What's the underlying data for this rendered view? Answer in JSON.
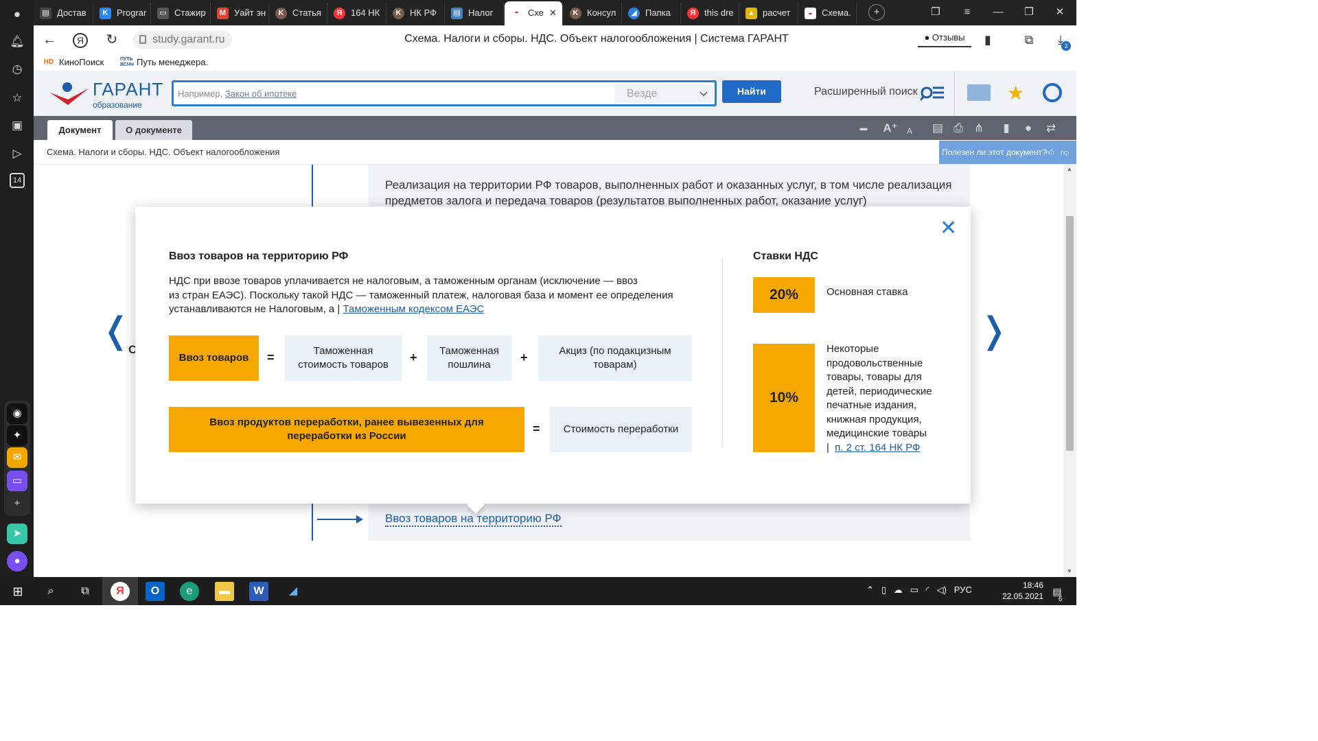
{
  "browser": {
    "tabs": [
      {
        "label": "Достав",
        "icon": "delivery-icon",
        "color": "#444"
      },
      {
        "label": "Prograr",
        "icon": "vk-icon",
        "color": "#2787f5"
      },
      {
        "label": "Стажир",
        "icon": "monitor-icon",
        "color": "#555"
      },
      {
        "label": "Уайт эн",
        "icon": "gmail-icon",
        "color": "#e44134"
      },
      {
        "label": "Статья",
        "icon": "consultant-icon",
        "color": "#7a5a4a"
      },
      {
        "label": "164 НК",
        "icon": "yandex-icon",
        "color": "#f33"
      },
      {
        "label": "НК РФ",
        "icon": "consultant-icon",
        "color": "#7a5a4a"
      },
      {
        "label": "Налог",
        "icon": "doc-icon",
        "color": "#4a7fc0"
      },
      {
        "label": "Схе",
        "icon": "garant-icon",
        "color": "#c22",
        "active": true
      },
      {
        "label": "Консул",
        "icon": "consultant-icon",
        "color": "#7a5a4a"
      },
      {
        "label": "Папка",
        "icon": "folder-icon",
        "color": "#2a80e0"
      },
      {
        "label": "this dre",
        "icon": "yandex-icon",
        "color": "#f33"
      },
      {
        "label": "расчет",
        "icon": "image-icon",
        "color": "#e8b400"
      },
      {
        "label": "Схема.",
        "icon": "garant-icon",
        "color": "#c22"
      }
    ],
    "url": "study.garant.ru",
    "page_title": "Схема. Налоги и сборы. НДС. Объект налогообложения | Система ГАРАНТ",
    "reviews_label": "Отзывы",
    "downloads_badge": "3",
    "bookmarks": [
      {
        "label": "КиноПоиск",
        "icon": "kinopoisk-icon"
      },
      {
        "label": "Путь менеджера.",
        "icon": "put-vsnn-icon"
      }
    ],
    "sidebar_badge": "14"
  },
  "garant": {
    "logo_word": "ГАРАНТ",
    "logo_sub": "образование",
    "search_placeholder_prefix": "Например,",
    "search_placeholder_link": "Закон об ипотеке",
    "search_scope": "Везде",
    "find_button": "Найти",
    "advanced_search": "Расширенный поиск",
    "doc_tabs": [
      "Документ",
      "О документе"
    ],
    "breadcrumb": "Схема. Налоги и сборы. НДС. Объект налогообложения",
    "helpful_prompt": "Полезен ли этот документ?"
  },
  "content": {
    "background_text": "Реализация на территории РФ товаров, выполненных работ и оказанных услуг, в том числе реализация предметов залога и передача товаров (результатов выполненных работ, оказание услуг)",
    "background_link": "Ввоз товаров на территорию РФ",
    "peek_char": "С"
  },
  "modal": {
    "title": "Ввоз товаров на территорию РФ",
    "text_lines": [
      "НДС при ввозе товаров уплачивается не налоговым, а таможенным органам (исключение — ввоз",
      "из  стран ЕАЭС). Поскольку такой НДС — таможенный платеж, налоговая база и момент ее определения",
      "устанавливаются не Налоговым, а  |  "
    ],
    "text_link": "Таможенным кодексом ЕАЭС",
    "formula1": {
      "result": "Ввоз товаров",
      "eq": "=",
      "terms": [
        "Таможенная стоимость товаров",
        "Таможенная пошлина",
        "Акциз (по подакцизным товарам)"
      ],
      "plus": "+"
    },
    "formula2": {
      "result": "Ввоз продуктов переработки, ранее вывезенных для переработки из России",
      "eq": "=",
      "term": "Стоимость переработки"
    },
    "rates_title": "Ставки НДС",
    "rates": [
      {
        "value": "20%",
        "desc": "Основная ставка"
      },
      {
        "value": "10%",
        "desc": "Некоторые продовольственные товары, товары для детей, периодические печатные издания, книжная продукция, медицинские товары",
        "link": "п. 2 ст. 164 НК РФ"
      }
    ]
  },
  "taskbar": {
    "language": "РУС",
    "time": "18:46",
    "date": "22.05.2021",
    "notifications": "6"
  },
  "colors": {
    "accent_orange": "#f6a800",
    "garant_blue": "#1d5ea8",
    "light_blue_box": "#eaf0f7"
  }
}
